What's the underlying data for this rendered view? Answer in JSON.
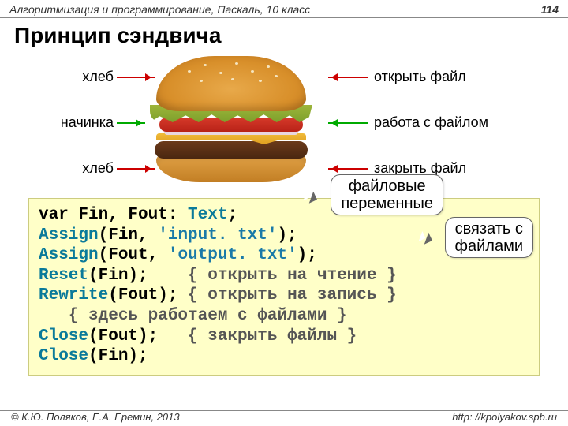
{
  "header": {
    "course": "Алгоритмизация и программирование, Паскаль, 10 класс",
    "page": "114"
  },
  "title": "Принцип сэндвича",
  "diagram": {
    "left": {
      "top": "хлеб",
      "mid": "начинка",
      "bot": "хлеб"
    },
    "right": {
      "top": "открыть файл",
      "mid": "работа с  файлом",
      "bot": "закрыть файл"
    }
  },
  "callouts": {
    "vars": {
      "l1": "файловые",
      "l2": "переменные"
    },
    "assoc": {
      "l1": "связать с",
      "l2": "файлами"
    }
  },
  "code": {
    "l1a": "var",
    "l1b": " Fin, Fout: ",
    "l1c": "Text",
    "l1d": ";",
    "l2a": "Assign",
    "l2b": "(Fin, ",
    "l2c": "'input. txt'",
    "l2d": ");",
    "l3a": "Assign",
    "l3b": "(Fout, ",
    "l3c": "'output. txt'",
    "l3d": ");",
    "l4a": "Reset",
    "l4b": "(Fin);    ",
    "l4c": "{ открыть на чтение }",
    "l5a": "Rewrite",
    "l5b": "(Fout); ",
    "l5c": "{ открыть на запись }",
    "l6": "   { здесь работаем с файлами }",
    "l7a": "Close",
    "l7b": "(Fout);   ",
    "l7c": "{ закрыть файлы }",
    "l8a": "Close",
    "l8b": "(Fin);"
  },
  "footer": {
    "copyright": "© К.Ю. Поляков, Е.А. Еремин, 2013",
    "url": "http: //kpolyakov.spb.ru"
  }
}
